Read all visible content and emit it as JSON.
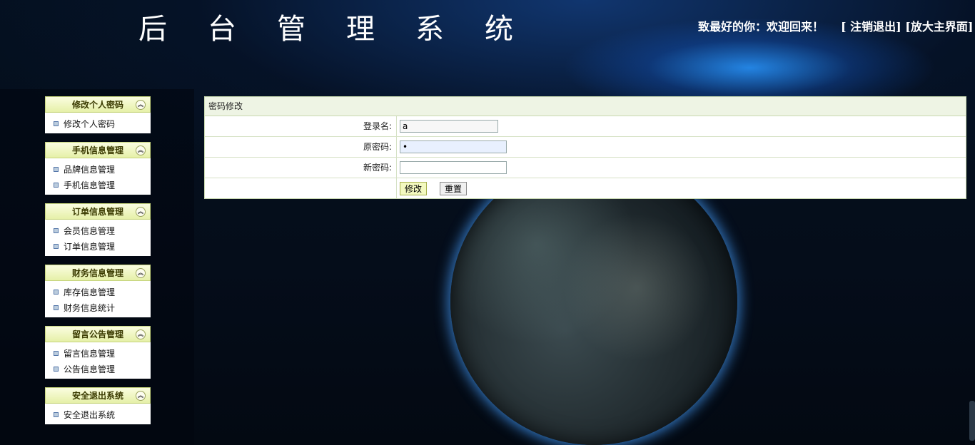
{
  "header": {
    "title": "后台管理系统",
    "welcome": "致最好的你：欢迎回来！",
    "logout_label": "[ 注销退出]",
    "enlarge_label": "[放大主界面]"
  },
  "sidebar": {
    "groups": [
      {
        "title": "修改个人密码",
        "items": [
          "修改个人密码"
        ]
      },
      {
        "title": "手机信息管理",
        "items": [
          "品牌信息管理",
          "手机信息管理"
        ]
      },
      {
        "title": "订单信息管理",
        "items": [
          "会员信息管理",
          "订单信息管理"
        ]
      },
      {
        "title": "财务信息管理",
        "items": [
          "库存信息管理",
          "财务信息统计"
        ]
      },
      {
        "title": "留言公告管理",
        "items": [
          "留言信息管理",
          "公告信息管理"
        ]
      },
      {
        "title": "安全退出系统",
        "items": [
          "安全退出系统"
        ]
      }
    ]
  },
  "form": {
    "title": "密码修改",
    "username_label": "登录名:",
    "username_value": "a",
    "old_password_label": "原密码:",
    "old_password_value": "a",
    "new_password_label": "新密码:",
    "new_password_value": "",
    "submit_label": "修改",
    "reset_label": "重置"
  },
  "colors": {
    "menu_header": "#e6f0a8",
    "panel_header": "#eef4e4",
    "background": "#040b17"
  }
}
